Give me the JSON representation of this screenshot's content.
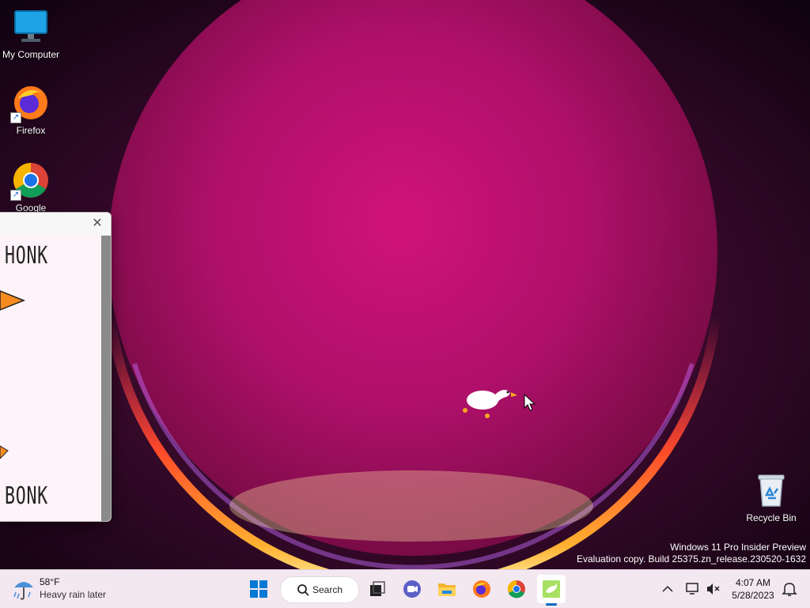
{
  "desktop": {
    "icons": [
      {
        "label": "My Computer",
        "icon": "monitor-icon"
      },
      {
        "label": "Firefox",
        "icon": "firefox-icon"
      },
      {
        "label": "Google",
        "icon": "chrome-icon"
      },
      {
        "label": "Recycle Bin",
        "icon": "recycle-bin-icon"
      }
    ]
  },
  "meme_window": {
    "text_top": "HONK",
    "text_bottom": "BONK"
  },
  "watermark": {
    "line1": "Windows 11 Pro Insider Preview",
    "line2": "Evaluation copy. Build 25375.zn_release.230520-1632"
  },
  "taskbar": {
    "weather": {
      "temp": "58°F",
      "condition": "Heavy rain later"
    },
    "search_label": "Search",
    "apps": [
      "start-icon",
      "task-view-icon",
      "meet-icon",
      "file-explorer-icon",
      "firefox-icon",
      "chrome-icon",
      "desktop-goose-icon"
    ],
    "active_app": "desktop-goose-icon",
    "clock": {
      "time": "4:07 AM",
      "date": "5/28/2023"
    }
  },
  "colors": {
    "accent": "#0067c0",
    "taskbar_bg": "#f3e7f0"
  }
}
